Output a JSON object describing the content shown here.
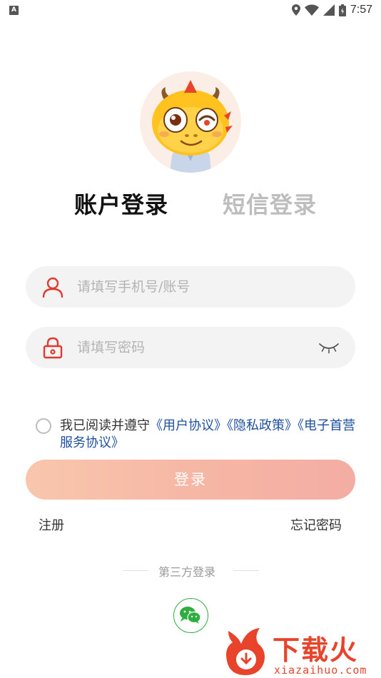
{
  "status_bar": {
    "notification_icon_label": "A",
    "time": "7:57"
  },
  "tabs": {
    "account_login": "账户登录",
    "sms_login": "短信登录"
  },
  "phone_field": {
    "placeholder": "请填写手机号/账号",
    "value": ""
  },
  "password_field": {
    "placeholder": "请填写密码",
    "value": ""
  },
  "agreement": {
    "prefix": "我已阅读并遵守",
    "link_user": "《用户协议》",
    "link_privacy": "《隐私政策》",
    "link_service": "《电子首营服务协议》"
  },
  "login_button": "登录",
  "register_link": "注册",
  "forgot_link": "忘记密码",
  "third_party_label": "第三方登录",
  "watermark": {
    "title": "下载火",
    "url": "xiazaihuo.com"
  },
  "colors": {
    "primary_gradient_start": "#f9c6ad",
    "primary_gradient_end": "#f3ada4",
    "icon_red": "#e03a30",
    "link_blue": "#1f4f9e",
    "wechat_green": "#2dae3f"
  },
  "icons": [
    "location-icon",
    "wifi-icon",
    "signal-icon",
    "battery-icon",
    "user-icon",
    "lock-icon",
    "eye-closed-icon",
    "wechat-icon"
  ]
}
